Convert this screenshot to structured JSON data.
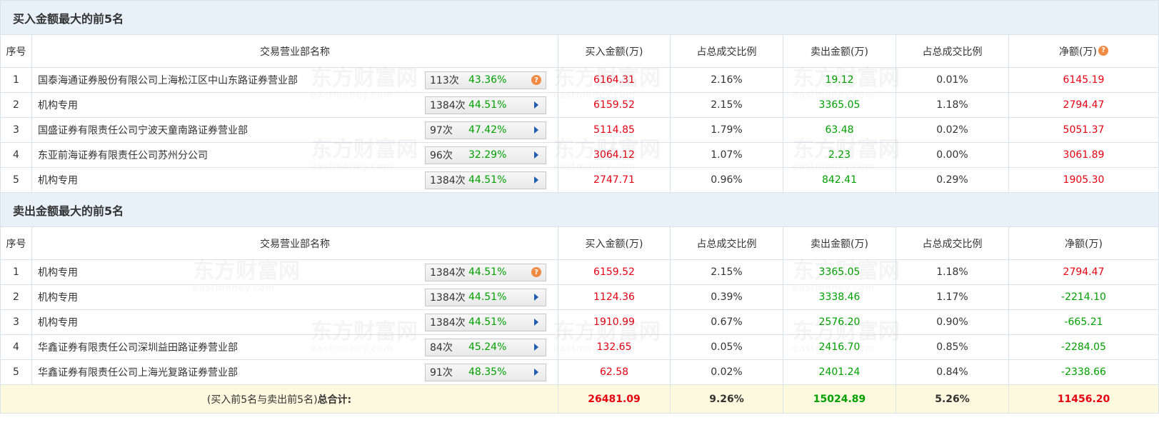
{
  "buy_section": {
    "title": "买入金额最大的前5名",
    "headers": [
      "序号",
      "交易营业部名称",
      "买入金额(万)",
      "占总成交比例",
      "卖出金额(万)",
      "占总成交比例",
      "净额(万)"
    ],
    "rows": [
      {
        "idx": "1",
        "name": "国泰海通证券股份有限公司上海松江区中山东路证券营业部",
        "count": "113次",
        "rate": "43.36%",
        "buy": "6164.31",
        "buy_pct": "2.16%",
        "sell": "19.12",
        "sell_pct": "0.01%",
        "net": "6145.19"
      },
      {
        "idx": "2",
        "name": "机构专用",
        "count": "1384次",
        "rate": "44.51%",
        "buy": "6159.52",
        "buy_pct": "2.15%",
        "sell": "3365.05",
        "sell_pct": "1.18%",
        "net": "2794.47"
      },
      {
        "idx": "3",
        "name": "国盛证券有限责任公司宁波天童南路证券营业部",
        "count": "97次",
        "rate": "47.42%",
        "buy": "5114.85",
        "buy_pct": "1.79%",
        "sell": "63.48",
        "sell_pct": "0.02%",
        "net": "5051.37"
      },
      {
        "idx": "4",
        "name": "东亚前海证券有限责任公司苏州分公司",
        "count": "96次",
        "rate": "32.29%",
        "buy": "3064.12",
        "buy_pct": "1.07%",
        "sell": "2.23",
        "sell_pct": "0.00%",
        "net": "3061.89"
      },
      {
        "idx": "5",
        "name": "机构专用",
        "count": "1384次",
        "rate": "44.51%",
        "buy": "2747.71",
        "buy_pct": "0.96%",
        "sell": "842.41",
        "sell_pct": "0.29%",
        "net": "1905.30"
      }
    ]
  },
  "sell_section": {
    "title": "卖出金额最大的前5名",
    "headers": [
      "序号",
      "交易营业部名称",
      "买入金额(万)",
      "占总成交比例",
      "卖出金额(万)",
      "占总成交比例",
      "净额(万)"
    ],
    "rows": [
      {
        "idx": "1",
        "name": "机构专用",
        "count": "1384次",
        "rate": "44.51%",
        "buy": "6159.52",
        "buy_pct": "2.15%",
        "sell": "3365.05",
        "sell_pct": "1.18%",
        "net": "2794.47"
      },
      {
        "idx": "2",
        "name": "机构专用",
        "count": "1384次",
        "rate": "44.51%",
        "buy": "1124.36",
        "buy_pct": "0.39%",
        "sell": "3338.46",
        "sell_pct": "1.17%",
        "net": "-2214.10"
      },
      {
        "idx": "3",
        "name": "机构专用",
        "count": "1384次",
        "rate": "44.51%",
        "buy": "1910.99",
        "buy_pct": "0.67%",
        "sell": "2576.20",
        "sell_pct": "0.90%",
        "net": "-665.21"
      },
      {
        "idx": "4",
        "name": "华鑫证券有限责任公司深圳益田路证券营业部",
        "count": "84次",
        "rate": "45.24%",
        "buy": "132.65",
        "buy_pct": "0.05%",
        "sell": "2416.70",
        "sell_pct": "0.85%",
        "net": "-2284.05"
      },
      {
        "idx": "5",
        "name": "华鑫证券有限责任公司上海光复路证券营业部",
        "count": "91次",
        "rate": "48.35%",
        "buy": "62.58",
        "buy_pct": "0.02%",
        "sell": "2401.24",
        "sell_pct": "0.84%",
        "net": "-2338.66"
      }
    ]
  },
  "total": {
    "label_prefix": "(买入前5名与卖出前5名)",
    "label_bold": "总合计:",
    "buy": "26481.09",
    "buy_pct": "9.26%",
    "sell": "15024.89",
    "sell_pct": "5.26%",
    "net": "11456.20"
  },
  "watermark": {
    "brand": "东方财富网",
    "domain": "eastmoney.com"
  },
  "icons": {
    "help": "question-mark-icon",
    "expand": "play-triangle-icon"
  },
  "colors": {
    "buy": "#e60012",
    "sell": "#00a000",
    "header_bg": "#e8f1f9",
    "total_bg": "#fdf9de",
    "qmark": "#f08a45",
    "arrow": "#1e5db0"
  }
}
